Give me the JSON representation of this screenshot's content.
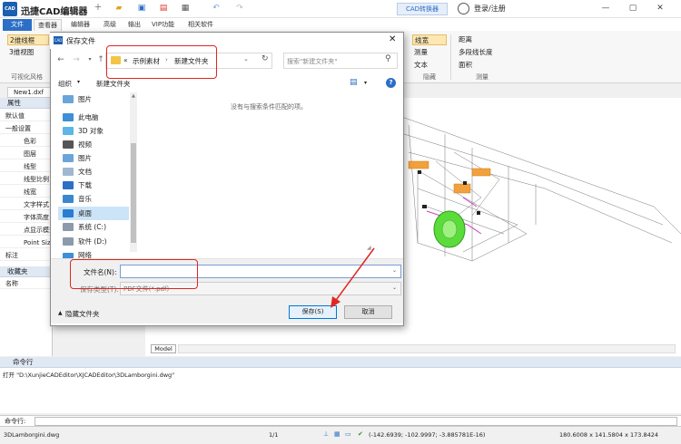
{
  "app": {
    "title": "迅捷CAD编辑器",
    "logo_text": "CAD",
    "converter_label": "CAD转换器",
    "login_label": "登录/注册"
  },
  "menu": {
    "items": [
      "文件",
      "查看器",
      "编辑器",
      "高级",
      "输出",
      "VIP功能",
      "相关软件"
    ]
  },
  "ribbon": {
    "left_buttons": [
      "2维线框",
      "3维视图"
    ],
    "group_visual": "可视化风格",
    "hide_buttons": [
      "线宽",
      "测量",
      "文本"
    ],
    "group_hide": "隐藏",
    "measure_buttons": [
      "距离",
      "多段线长度",
      "面积"
    ],
    "group_measure": "测量"
  },
  "document": {
    "tab": "New1.dxf",
    "model_tab": "Model"
  },
  "properties": {
    "header": "属性",
    "default_label": "默认值",
    "general": "一般设置",
    "rows": [
      "色彩",
      "图层",
      "线型",
      "线型比例",
      "线宽",
      "文字样式",
      "字体高度",
      "点显示模式",
      "Point Size"
    ],
    "annotation": "标注"
  },
  "favorites": {
    "header": "收藏夹",
    "column": "名称"
  },
  "dialog": {
    "title": "保存文件",
    "close": "✕",
    "breadcrumb_prefix": "«",
    "breadcrumb": [
      "示例素材",
      "新建文件夹"
    ],
    "search_placeholder": "搜索\"新建文件夹\"",
    "organize": "组织",
    "new_folder": "新建文件夹",
    "empty_message": "没有与搜索条件匹配的项。",
    "nav_items": [
      "图片",
      "此电脑",
      "3D 对象",
      "视频",
      "图片",
      "文档",
      "下载",
      "音乐",
      "桌面",
      "系统 (C:)",
      "软件 (D:)",
      "网络"
    ],
    "filename_label": "文件名(N):",
    "filename_value": "",
    "filetype_label": "保存类型(T):",
    "filetype_value": "PDF文件(*.pdf)",
    "hide_folders": "隐藏文件夹",
    "save": "保存(S)",
    "cancel": "取消"
  },
  "command": {
    "header": "命令行",
    "output": "打开 \"D:\\XunjieCADEditor\\XJCADEditor\\3DLamborgini.dwg\"",
    "input_label": "命令行:"
  },
  "status": {
    "file": "3DLamborgini.dwg",
    "page": "1/1",
    "coords": "(-142.6939; -102.9997; -3.885781E-16)",
    "size": "180.6008 x 141.5804 x 173.8424"
  },
  "colors": {
    "accent": "#2b6fc6",
    "highlight": "#e0261f",
    "selection": "#cce4f7"
  }
}
